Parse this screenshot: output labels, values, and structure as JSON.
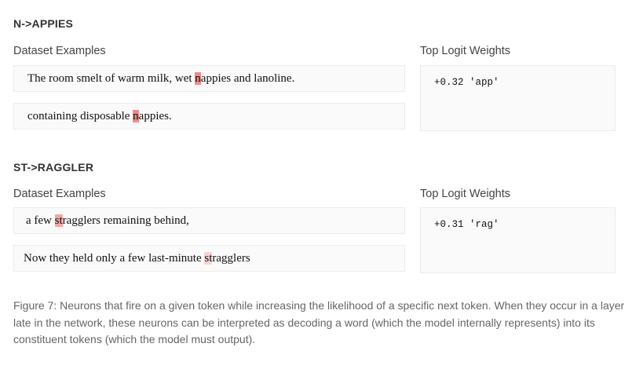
{
  "neurons": [
    {
      "title": "N->APPIES",
      "examples_label": "Dataset Examples",
      "logits_label": "Top Logit Weights",
      "examples": [
        {
          "tokens": [
            {
              "text": "The room smelt of warm milk, wet ",
              "level": "none"
            },
            {
              "text": "n",
              "level": "strong"
            },
            {
              "text": "appies and lanoline.",
              "level": "none"
            }
          ]
        },
        {
          "tokens": [
            {
              "text": "containing disposable ",
              "level": "none"
            },
            {
              "text": "n",
              "level": "strong"
            },
            {
              "text": "appies.",
              "level": "none"
            }
          ]
        }
      ],
      "logits": [
        {
          "weight": "+0.32",
          "token": "'app'"
        }
      ]
    },
    {
      "title": "ST->RAGGLER",
      "examples_label": "Dataset Examples",
      "logits_label": "Top Logit Weights",
      "examples": [
        {
          "tokens": [
            {
              "text": "a few ",
              "level": "none"
            },
            {
              "text": "st",
              "level": "mid"
            },
            {
              "text": "ragglers remaining behind,",
              "level": "none"
            }
          ]
        },
        {
          "tokens": [
            {
              "text": "Now they held only a few last-minute ",
              "level": "none"
            },
            {
              "text": "st",
              "level": "light"
            },
            {
              "text": "ragglers",
              "level": "none"
            }
          ]
        }
      ],
      "logits": [
        {
          "weight": "+0.31",
          "token": "'rag'"
        }
      ]
    }
  ],
  "caption": "Figure 7: Neurons that fire on a given token while increasing the likelihood of a specific next token.  When they occur in a layer late in the network, these neurons can be interpreted as decoding a word (which the model internally represents) into its constituent tokens (which the model must output).",
  "colors": {
    "highlight_strong": "#f08a8a",
    "highlight_mid": "#f4a6a6",
    "highlight_light": "#f9d2d2",
    "box_background": "#fafafa",
    "box_border": "#ececec"
  }
}
